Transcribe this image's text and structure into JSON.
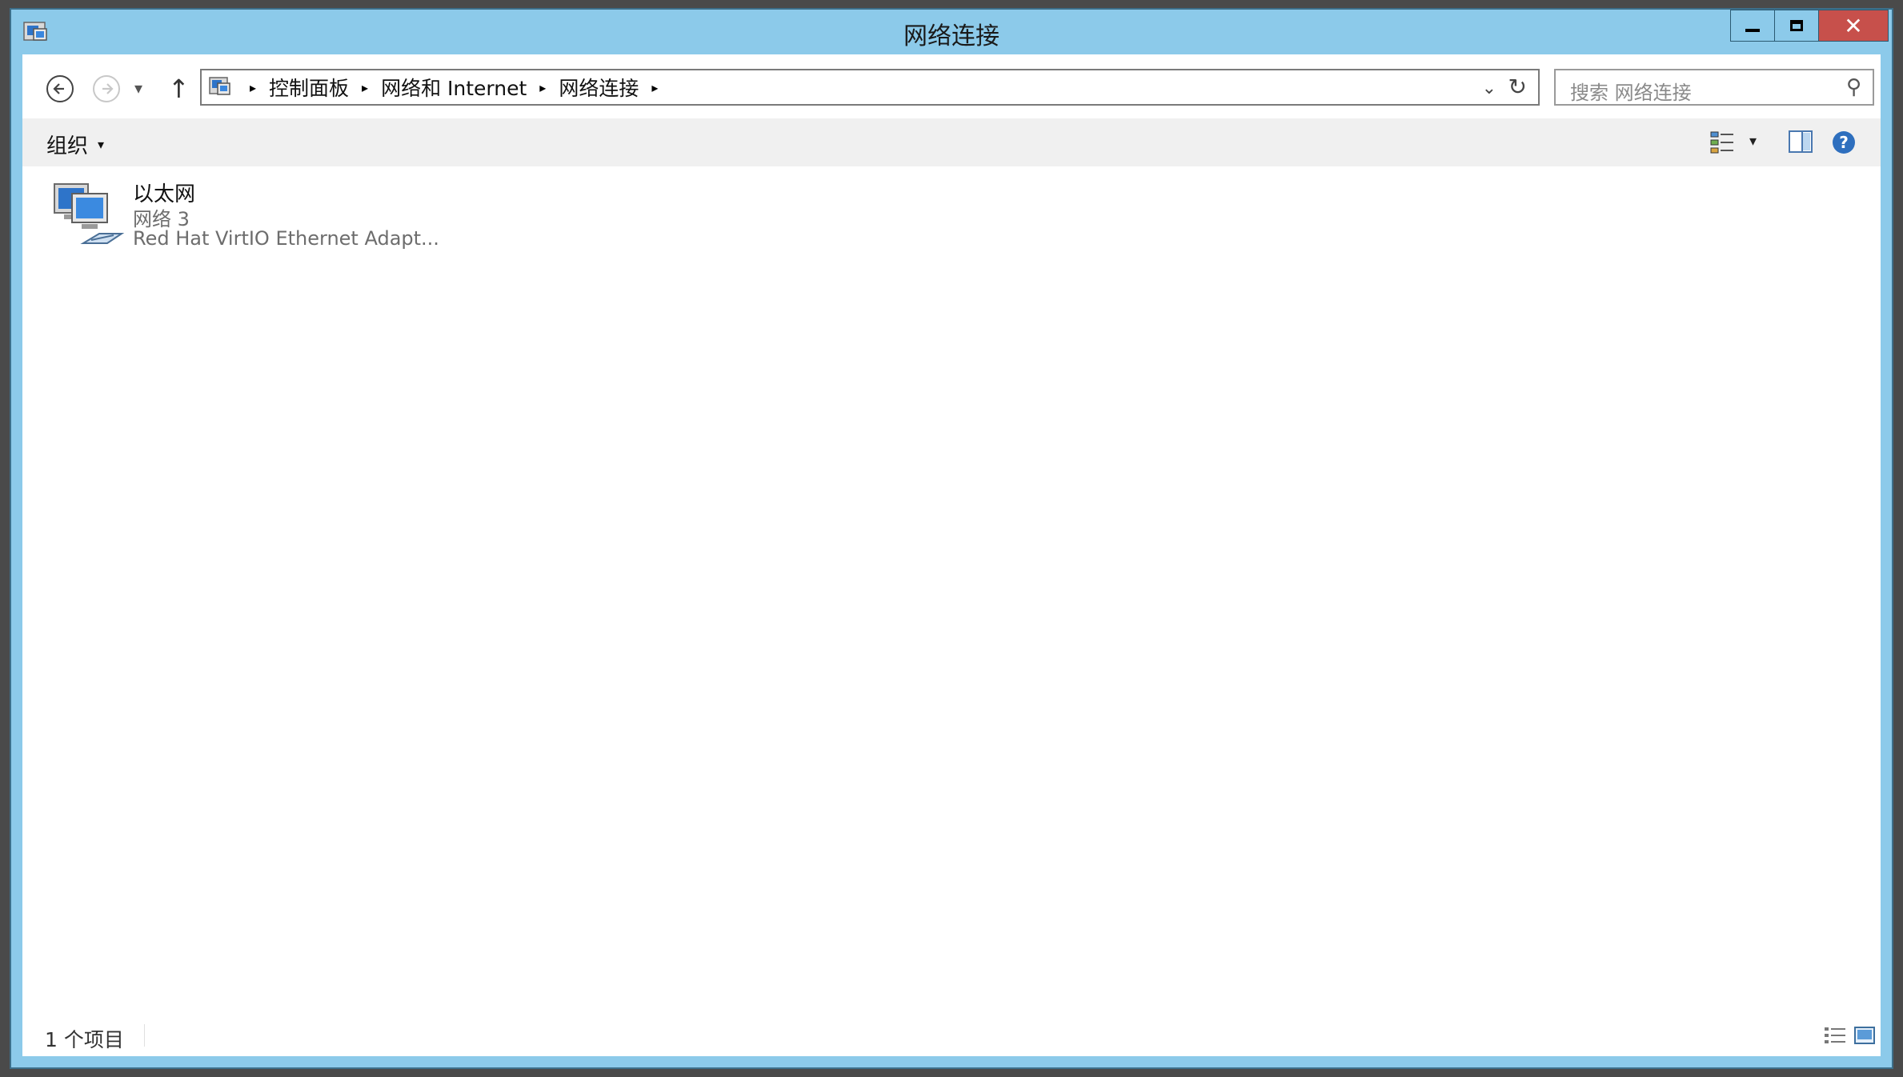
{
  "window": {
    "title": "网络连接",
    "close_symbol": "✕",
    "icon_names": {
      "app": "network-connections-icon",
      "minimize": "minimize-icon",
      "maximize": "maximize-icon",
      "close": "close-icon"
    }
  },
  "nav": {
    "up_arrow": "↑",
    "dropdown_caret": "▾",
    "breadcrumb": [
      "控制面板",
      "网络和 Internet",
      "网络连接"
    ],
    "separator": "▸",
    "address_dropdown": "⌄",
    "refresh": "↻"
  },
  "search": {
    "placeholder": "搜索 网络连接",
    "icon": "⚲"
  },
  "toolbar": {
    "organize_label": "组织",
    "organize_caret": "▾",
    "view_caret": "▾",
    "help_symbol": "?"
  },
  "connections": [
    {
      "name": "以太网",
      "network": "网络  3",
      "adapter": "Red Hat VirtIO Ethernet Adapt..."
    }
  ],
  "status": {
    "item_count": "1 个项目"
  },
  "colors": {
    "titlebar": "#8ccaea",
    "close_button": "#c7504b",
    "commandbar": "#f0f0f0",
    "secondary_text": "#6d6d6d"
  }
}
